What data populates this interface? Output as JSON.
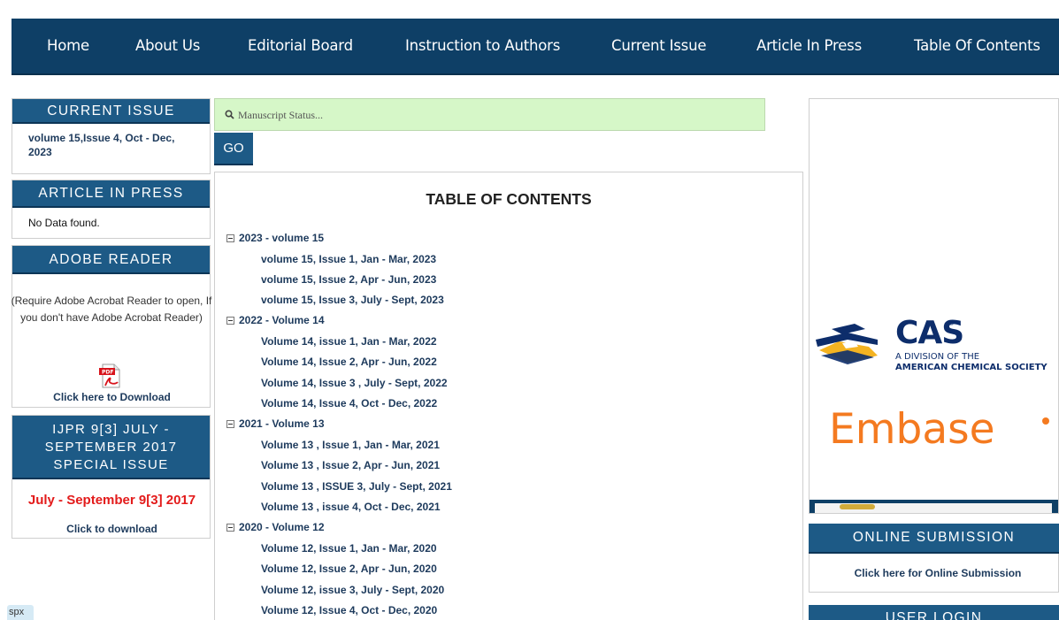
{
  "nav": {
    "items": [
      "Home",
      "About Us",
      "Editorial Board",
      "Instruction to Authors",
      "Current Issue",
      "Article In Press",
      "Table Of Contents"
    ]
  },
  "current_issue": {
    "heading": "CURRENT ISSUE",
    "text": "volume 15,Issue 4, Oct - Dec, 2023"
  },
  "article_in_press": {
    "heading": "ARTICLE IN PRESS",
    "text": "No Data found."
  },
  "adobe_reader": {
    "heading": "ADOBE READER",
    "note": "(Require Adobe Acrobat Reader to open, If you don't have Adobe Acrobat Reader)",
    "icon": "pdf-icon",
    "link": "Click here to Download"
  },
  "special_issue": {
    "heading": "IJPR 9[3] JULY - SEPTEMBER 2017 SPECIAL ISSUE",
    "title": "July - September 9[3] 2017",
    "link": "Click to download"
  },
  "search": {
    "placeholder": "Manuscript Status...",
    "button": "GO"
  },
  "toc": {
    "title": "TABLE OF CONTENTS",
    "years": [
      {
        "label": "2023 - volume 15",
        "issues": [
          "volume 15, Issue 1, Jan - Mar, 2023",
          "volume 15, Issue 2, Apr - Jun, 2023",
          "volume 15, Issue 3, July - Sept, 2023"
        ]
      },
      {
        "label": "2022 - Volume 14",
        "issues": [
          "Volume 14, issue 1, Jan - Mar, 2022",
          "Volume 14, Issue 2, Apr - Jun, 2022",
          "Volume 14, Issue 3 , July - Sept, 2022",
          "Volume 14, Issue 4, Oct - Dec, 2022"
        ]
      },
      {
        "label": "2021 - Volume 13",
        "issues": [
          "Volume 13 , Issue 1, Jan - Mar, 2021",
          "Volume 13 , Issue 2, Apr - Jun, 2021",
          "Volume 13 , ISSUE 3, July - Sept, 2021",
          "Volume 13 , issue 4, Oct - Dec, 2021"
        ]
      },
      {
        "label": "2020 - Volume 12",
        "issues": [
          "Volume 12, Issue 1, Jan - Mar, 2020",
          "Volume 12, Issue 2, Apr - Jun, 2020",
          "Volume 12, issue 3, July - Sept, 2020",
          "Volume 12, Issue 4, Oct - Dec, 2020"
        ]
      }
    ]
  },
  "indexing": {
    "cas_name": "CAS",
    "cas_line1": "A DIVISION OF THE",
    "cas_line2": "AMERICAN CHEMICAL SOCIETY",
    "embase": "Embase"
  },
  "online_submission": {
    "heading": "ONLINE SUBMISSION",
    "link": "Click here for Online Submission"
  },
  "user_login": {
    "heading": "USER LOGIN"
  },
  "corner_tab": "spx",
  "colors": {
    "nav_bg": "#0e3f66",
    "header_bg": "#1d5a86",
    "search_bg": "#d6f7c8",
    "special_red": "#e31b1b",
    "embase_orange": "#f47a20",
    "cas_blue": "#0d2d6b",
    "cas_gold": "#f4b321"
  }
}
